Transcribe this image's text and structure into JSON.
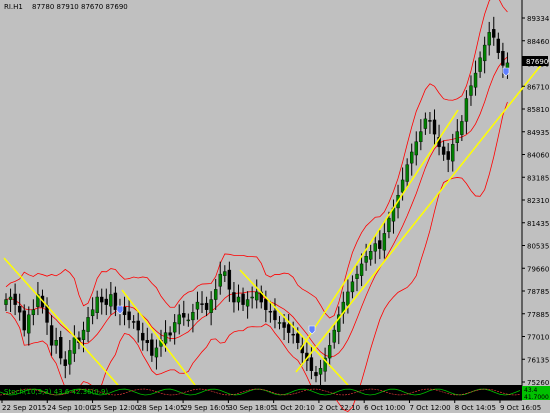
{
  "header": {
    "symbol_tf": "RI.H1",
    "ohlc": "87780 87910 87670 87690"
  },
  "price_axis": {
    "labels": [
      "89334",
      "88460",
      "87690",
      "86710",
      "85810",
      "84935",
      "84060",
      "83185",
      "82310",
      "81435",
      "80535",
      "79660",
      "78785",
      "77885",
      "77010",
      "76135",
      "75260"
    ],
    "current_price": "87690",
    "current_price_color": "#ffffff"
  },
  "time_axis": {
    "labels": [
      "22 Sep 2015",
      "24 Sep 10:00",
      "25 Sep 12:00",
      "28 Sep 14:05",
      "29 Sep 16:05",
      "30 Sep 18:05",
      "1 Oct 20:10",
      "2 Oct 22:10",
      "6 Oct 10:00",
      "7 Oct 12:00",
      "8 Oct 14:05",
      "9 Oct 16:05"
    ]
  },
  "indicator_panel": {
    "label": "Stoch(10,3,3) 43.6 42.36(0.9)",
    "right_values": [
      "43.4",
      "41.7000"
    ],
    "color": "#00c000"
  },
  "colors": {
    "background": "#c0c0c0",
    "bands": "#ff0000",
    "trendlines": "#ffff00",
    "bull_candle": "#008000",
    "bear_candle": "#000000",
    "wick": "#000000",
    "indicator_bg": "#000000"
  },
  "icons": [
    "arrow-marker-icon",
    "arrow-marker-icon",
    "arrow-marker-icon"
  ],
  "chart_data": {
    "type": "candlestick",
    "title": "",
    "series_close": [
      78500,
      78600,
      78300,
      78000,
      77300,
      77900,
      78100,
      78700,
      78200,
      77600,
      76700,
      76900,
      76200,
      75900,
      76500,
      77000,
      76800,
      77300,
      77800,
      78100,
      78600,
      78400,
      78300,
      78700,
      78100,
      78200,
      77900,
      77700,
      77600,
      77300,
      76900,
      76800,
      76300,
      76600,
      76900,
      77200,
      77100,
      77600,
      77900,
      77800,
      77700,
      78000,
      78400,
      78300,
      78100,
      78500,
      78900,
      79500,
      79600,
      78900,
      78400,
      78600,
      78300,
      78500,
      78600,
      78800,
      78400,
      78100,
      78000,
      77700,
      77600,
      77400,
      77200,
      77100,
      76800,
      76400,
      76100,
      75700,
      75500,
      75800,
      76200,
      76700,
      77300,
      77900,
      78400,
      78800,
      79200,
      79500,
      79900,
      80200,
      80400,
      80700,
      80500,
      81100,
      81700,
      82100,
      82600,
      83200,
      83800,
      84300,
      84700,
      85100,
      85600,
      85500,
      85000,
      84500,
      84200,
      84000,
      84600,
      85100,
      85500,
      86400,
      86900,
      87400,
      88000,
      88500,
      89000,
      88800,
      88200,
      87700,
      87800
    ],
    "ylim": [
      75260,
      89800
    ]
  }
}
